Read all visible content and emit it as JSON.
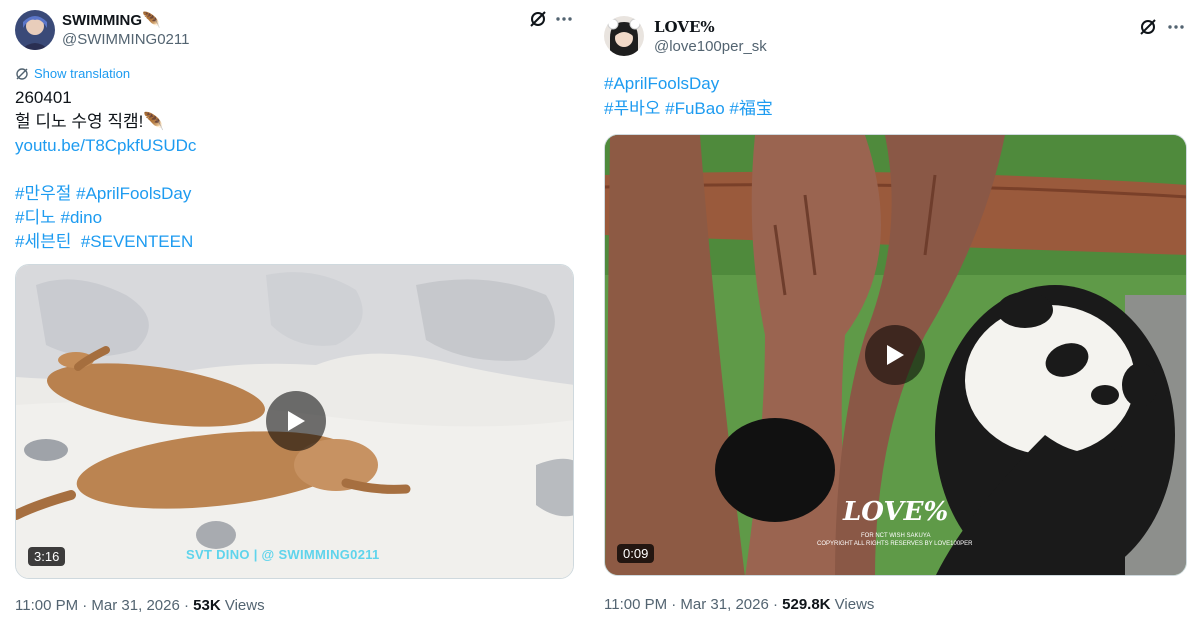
{
  "tweets": [
    {
      "display_name": "SWIMMING🪶",
      "handle": "@SWIMMING0211",
      "show_translation": "Show translation",
      "text_lines": [
        "260401",
        "헐 디노 수영 직캠!🪶"
      ],
      "link": "youtu.be/T8CpkfUSUDc",
      "hashtag_lines": [
        [
          "#만우절",
          "#AprilFoolsDay"
        ],
        [
          "#디노",
          "#dino"
        ],
        [
          "#세븐틴",
          "#SEVENTEEN"
        ]
      ],
      "video": {
        "duration": "3:16",
        "watermark": "SVT DINO | @ SWIMMING0211"
      },
      "timestamp": "11:00 PM · Mar 31, 2026 · ",
      "views_count": "53K",
      "views_label": " Views"
    },
    {
      "display_name": "LOVE%",
      "handle": "@love100per_sk",
      "hashtag_lines": [
        [
          "#AprilFoolsDay"
        ],
        [
          "#푸바오",
          "#FuBao",
          "#福宝"
        ]
      ],
      "video": {
        "duration": "0:09",
        "watermark_logo": "LOVE%",
        "watermark_sub1": "FOR NCT WISH SAKUYA",
        "watermark_sub2": "COPYRIGHT ALL RIGHTS RESERVES BY LOVE100PER"
      },
      "timestamp": "11:00 PM · Mar 31, 2026 · ",
      "views_count": "529.8K",
      "views_label": " Views"
    }
  ],
  "icons": {
    "grok": "grok-icon",
    "more": "more-horizontal-icon",
    "translate": "translate-icon",
    "play": "play-icon"
  },
  "colors": {
    "link": "#1d9bf0",
    "secondary_text": "#536471",
    "primary_text": "#0f1419"
  }
}
